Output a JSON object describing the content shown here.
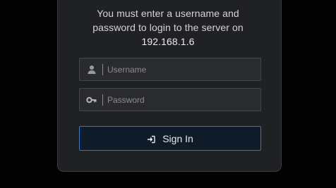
{
  "login": {
    "message_line1": "You must enter a username and",
    "message_line2": "password to login to the server on",
    "server_address": "192.168.1.6",
    "username": {
      "value": "",
      "placeholder": "Username",
      "icon": "user-icon"
    },
    "password": {
      "value": "",
      "placeholder": "Password",
      "icon": "key-icon"
    },
    "signin": {
      "label": "Sign In",
      "icon": "sign-in-icon"
    }
  },
  "colors": {
    "background": "#030303",
    "card": "#202124",
    "field": "#2a2b2e",
    "accent_border": "#2a7bd0",
    "button_bg": "#0f1b28",
    "text": "#d5d5d5",
    "placeholder": "#8c8d90"
  }
}
